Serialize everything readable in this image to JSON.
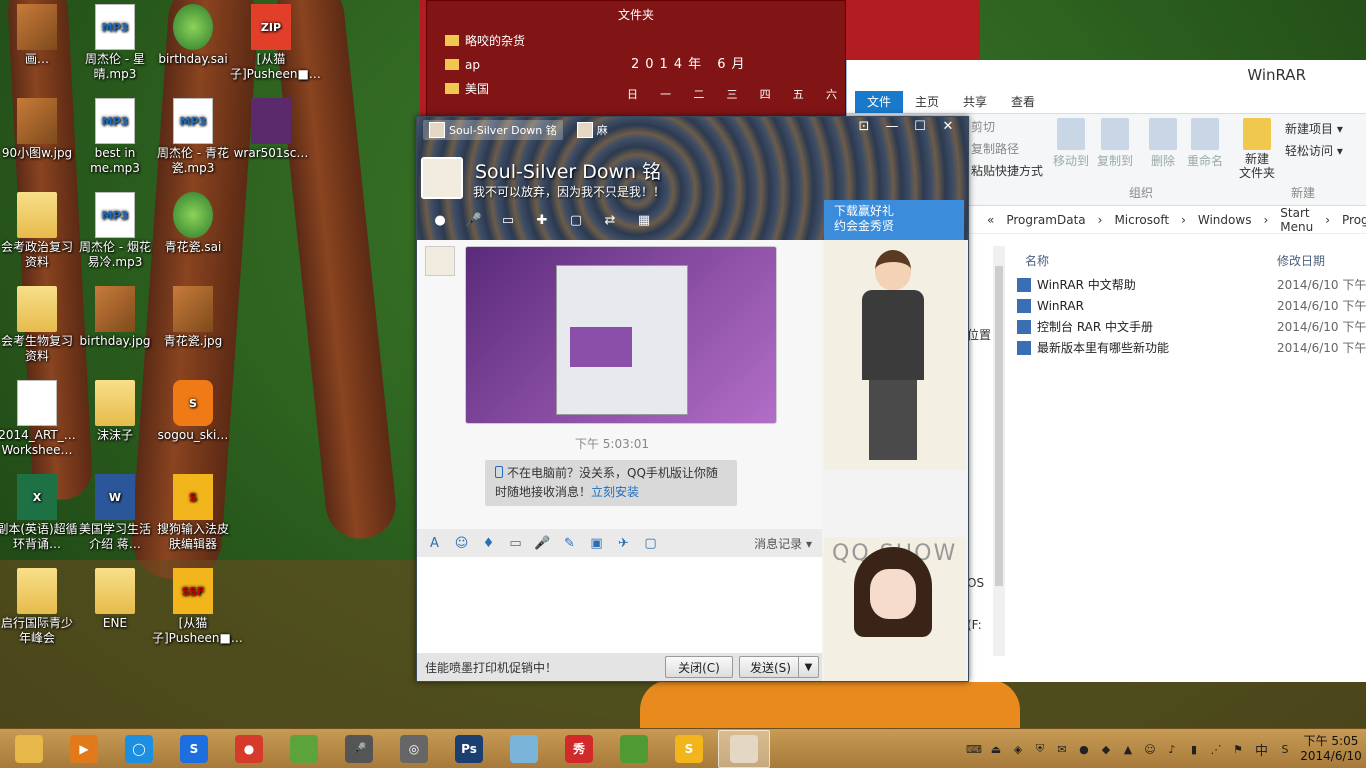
{
  "desktop": {
    "icons": [
      {
        "label": "画…",
        "type": "pic"
      },
      {
        "label": "周杰伦 - 星晴.mp3",
        "type": "file",
        "glyph": "MP3"
      },
      {
        "label": "birthday.sai",
        "type": "sai"
      },
      {
        "label": "[从猫子]Pusheen■…",
        "type": "zip",
        "glyph": "ZIP"
      },
      {
        "label": "90小图w.jpg",
        "type": "pic"
      },
      {
        "label": "best in me.mp3",
        "type": "file",
        "glyph": "MP3"
      },
      {
        "label": "周杰伦 - 青花瓷.mp3",
        "type": "file",
        "glyph": "MP3"
      },
      {
        "label": "wrar501sc…",
        "type": "rar"
      },
      {
        "label": "会考政治复习资料",
        "type": "folder"
      },
      {
        "label": "周杰伦 - 烟花易冷.mp3",
        "type": "file",
        "glyph": "MP3"
      },
      {
        "label": "青花瓷.sai",
        "type": "sai"
      },
      {
        "label": "会考生物复习资料",
        "type": "folder"
      },
      {
        "label": "birthday.jpg",
        "type": "pic"
      },
      {
        "label": "青花瓷.jpg",
        "type": "pic"
      },
      {
        "label": "2014_ART_…Workshee…",
        "type": "file",
        "glyph": ""
      },
      {
        "label": "沫沫子",
        "type": "folder"
      },
      {
        "label": "sogou_ski…",
        "type": "sogou",
        "glyph": "S"
      },
      {
        "label": "副本(英语)超循环背诵…",
        "type": "green",
        "glyph": "X"
      },
      {
        "label": "美国学习生活介绍 蒋…",
        "type": "blue",
        "glyph": "W"
      },
      {
        "label": "搜狗输入法皮肤编辑器",
        "type": "ssf",
        "glyph": "S"
      },
      {
        "label": "启行国际青少年峰会",
        "type": "folder"
      },
      {
        "label": "ENE",
        "type": "folder"
      },
      {
        "label": "[从猫子]Pusheen■…",
        "type": "ssf",
        "glyph": "SSF"
      }
    ]
  },
  "folder_panel": {
    "title": "文件夹",
    "items": [
      "略咬的杂货",
      "ap",
      "美国"
    ],
    "calendar": {
      "year_month": "2014年  6月",
      "weekdays": [
        "日",
        "一",
        "二",
        "三",
        "四",
        "五",
        "六"
      ]
    }
  },
  "explorer": {
    "title": "WinRAR",
    "tabs": [
      "文件",
      "主页",
      "共享",
      "查看"
    ],
    "ribbon": {
      "cut": "剪切",
      "copy_path": "复制路径",
      "paste_shortcut": "粘贴快捷方式",
      "move_to": "移动到",
      "copy_to": "复制到",
      "delete": "删除",
      "rename": "重命名",
      "group_organize": "组织",
      "new_folder": "新建\n文件夹",
      "new_item": "新建项目 ▾",
      "easy_access": "轻松访问 ▾",
      "group_new": "新建"
    },
    "address": [
      "«",
      "ProgramData",
      "›",
      "Microsoft",
      "›",
      "Windows",
      "›",
      "Start Menu",
      "›",
      "Prog"
    ],
    "columns": {
      "name": "名称",
      "date": "修改日期"
    },
    "files": [
      {
        "name": "WinRAR 中文帮助",
        "date": "2014/6/10 下午"
      },
      {
        "name": "WinRAR",
        "date": "2014/6/10 下午"
      },
      {
        "name": "控制台 RAR 中文手册",
        "date": "2014/6/10 下午"
      },
      {
        "name": "最新版本里有哪些新功能",
        "date": "2014/6/10 下午"
      }
    ],
    "side_fragments": [
      "位置",
      "OS",
      "(F:"
    ]
  },
  "chat": {
    "tabs": [
      "Soul-Silver Down 铭",
      "麻"
    ],
    "contact_name": "Soul-Silver Down 铭",
    "signature": "我不可以放弃，因为我不只是我！！",
    "ad_text": "下载赢好礼\n约会金秀贤",
    "message_time": "下午 5:03:01",
    "notice_text": "不在电脑前？没关系，QQ手机版让你随时随地接收消息！",
    "notice_link": "立刻安装",
    "history_label": "消息记录 ▾",
    "status_text": "佳能喷墨打印机促销中！",
    "close_button": "关闭(C)",
    "send_button": "发送(S)",
    "show_label": "QQ SHOW",
    "window_controls": [
      "⊡",
      "—",
      "☐",
      "✕"
    ],
    "toolbar_icons": [
      "●",
      "🎤",
      "▭",
      "✚",
      "▢",
      "⇄",
      "▦"
    ],
    "input_toolbar_icons": [
      "A",
      "☺",
      "♦",
      "▭",
      "🎤",
      "✎",
      "▣",
      "✈",
      "▢"
    ]
  },
  "taskbar": {
    "apps": [
      {
        "name": "file-explorer",
        "glyph": "",
        "color": "#e6b84a"
      },
      {
        "name": "media-player",
        "glyph": "▶",
        "color": "#e07a1a"
      },
      {
        "name": "qq-browser",
        "glyph": "◯",
        "color": "#1d8fe0"
      },
      {
        "name": "sogou-browser",
        "glyph": "S",
        "color": "#1d6fe0"
      },
      {
        "name": "chrome",
        "glyph": "●",
        "color": "#d63a2a"
      },
      {
        "name": "paint-tool-sai",
        "glyph": "",
        "color": "#5da33c"
      },
      {
        "name": "microphone",
        "glyph": "🎤",
        "color": "#555555"
      },
      {
        "name": "video-app",
        "glyph": "◎",
        "color": "#666666"
      },
      {
        "name": "photoshop",
        "glyph": "Ps",
        "color": "#1a3f70"
      },
      {
        "name": "notes-app",
        "glyph": "",
        "color": "#7ab4d8"
      },
      {
        "name": "meitu-xiuxiu",
        "glyph": "秀",
        "color": "#d22a2a"
      },
      {
        "name": "sai-app",
        "glyph": "",
        "color": "#4f9a32"
      },
      {
        "name": "ssf-editor",
        "glyph": "S",
        "color": "#f2b51b"
      },
      {
        "name": "qq-chat",
        "glyph": "",
        "color": "#e4d7c4"
      }
    ],
    "ime": "中",
    "time": "下午 5:05",
    "date": "2014/6/10"
  }
}
